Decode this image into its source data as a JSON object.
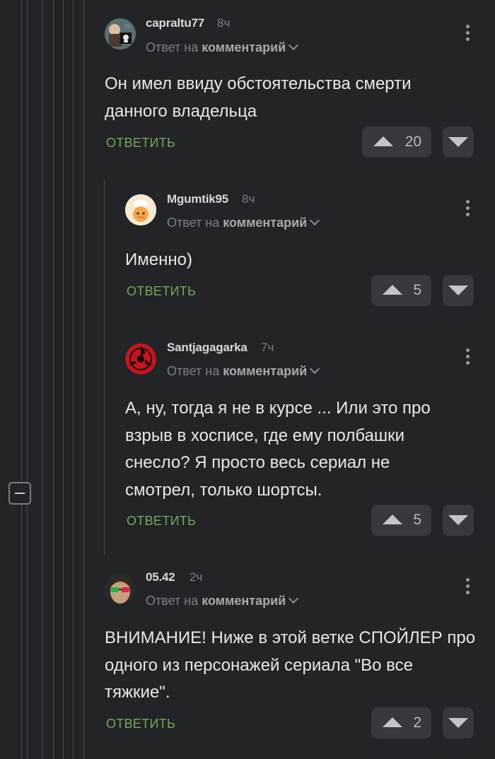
{
  "thread": {
    "collapse_icon": "minus-square-icon",
    "comments": [
      {
        "author": "capraltu77",
        "time": "8ч",
        "reply_prefix": "Ответ на",
        "reply_target": "комментарий",
        "text": "Он имел ввиду обстоятельства смерти данного владельца",
        "reply_label": "ОТВЕТИТЬ",
        "rating": "20",
        "avatar_icon": "user-avatar-skull"
      },
      {
        "author": "Mgumtik95",
        "time": "8ч",
        "reply_prefix": "Ответ на",
        "reply_target": "комментарий",
        "text": "Именно)",
        "reply_label": "ОТВЕТИТЬ",
        "rating": "5",
        "avatar_icon": "user-avatar-chef"
      },
      {
        "author": "Santjagagarka",
        "time": "7ч",
        "reply_prefix": "Ответ на",
        "reply_target": "комментарий",
        "text": "А, ну, тогда я не в курсе ... Или это про взрыв в хосписе, где ему полбашки снесло? Я просто весь сериал не смотрел, только шортсы.",
        "reply_label": "ОТВЕТИТЬ",
        "rating": "5",
        "avatar_icon": "user-avatar-sharingan"
      },
      {
        "author": "05.42",
        "time": "2ч",
        "reply_prefix": "Ответ на",
        "reply_target": "комментарий",
        "text": "ВНИМАНИЕ! Ниже в этой ветке СПОЙЛЕР про одного из персонажей сериала \"Во все тяжкие\".",
        "reply_label": "ОТВЕТИТЬ",
        "rating": "2",
        "avatar_icon": "user-avatar-sunglasses"
      }
    ]
  },
  "colors": {
    "background": "#232427",
    "reply_button": "#72a85a",
    "vote_button": "#37393e",
    "thread_line": "#4b4d52"
  }
}
